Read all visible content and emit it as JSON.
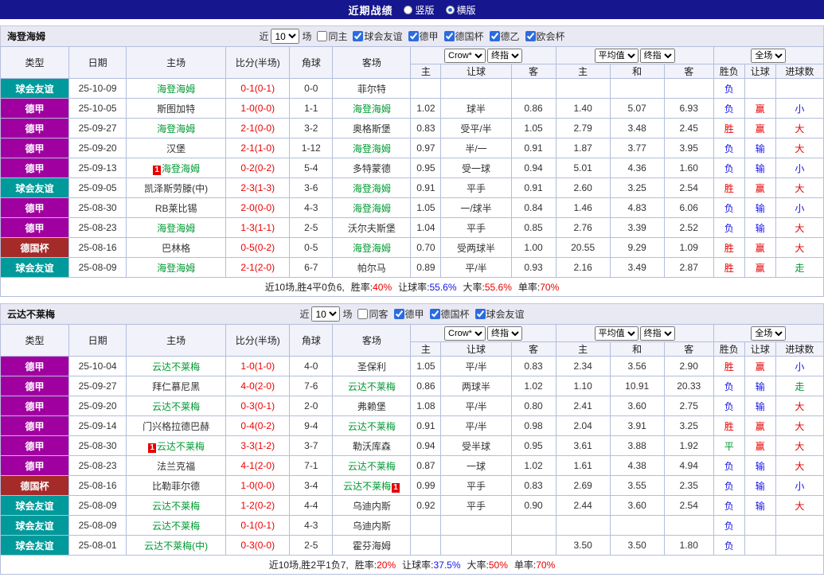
{
  "top_bar": {
    "title": "近期战绩",
    "layout_options": [
      {
        "label": "竖版",
        "selected": false
      },
      {
        "label": "横版",
        "selected": true
      }
    ]
  },
  "colors": {
    "league": {
      "球会友谊": "#009a9a",
      "德甲": "#a000a0",
      "德国杯": "#a52a2a"
    },
    "result": {
      "胜": "#e60000",
      "负": "#1414e6",
      "平": "#009933",
      "赢": "#e60000",
      "输": "#1414e6",
      "大": "#e60000",
      "小": "#1414e6",
      "走": "#009933"
    },
    "team_focus": "#009933",
    "score": "#ee0000"
  },
  "table_header": {
    "cols": [
      "类型",
      "日期",
      "主场",
      "比分(半场)",
      "角球",
      "客场"
    ],
    "odds_group1": {
      "select1": "Crow*",
      "select2": "终指",
      "sub": [
        "主",
        "让球",
        "客"
      ]
    },
    "odds_group2": {
      "select1": "平均值",
      "select2": "终指",
      "sub": [
        "主",
        "和",
        "客"
      ]
    },
    "result_group": {
      "select1": "全场",
      "sub": [
        "胜负",
        "让球",
        "进球数"
      ]
    }
  },
  "sections": [
    {
      "team": "海登海姆",
      "filter": {
        "near_label": "近",
        "count": "10",
        "games_label": "场",
        "same_label": "同主",
        "same_checked": false,
        "leagues": [
          {
            "label": "球会友谊",
            "checked": true
          },
          {
            "label": "德甲",
            "checked": true
          },
          {
            "label": "德国杯",
            "checked": true
          },
          {
            "label": "德乙",
            "checked": true
          },
          {
            "label": "欧会杯",
            "checked": true
          }
        ]
      },
      "rows": [
        {
          "league": "球会友谊",
          "date": "25-10-09",
          "home": {
            "name": "海登海姆",
            "focus": true
          },
          "score": "0-1(0-1)",
          "corner": "0-0",
          "away": {
            "name": "菲尔特",
            "focus": false
          },
          "odds": [
            "",
            "",
            ""
          ],
          "avg": [
            "",
            "",
            ""
          ],
          "result": [
            "负",
            "",
            ""
          ]
        },
        {
          "league": "德甲",
          "date": "25-10-05",
          "home": {
            "name": "斯图加特",
            "focus": false
          },
          "score": "1-0(0-0)",
          "corner": "1-1",
          "away": {
            "name": "海登海姆",
            "focus": true
          },
          "odds": [
            "1.02",
            "球半",
            "0.86"
          ],
          "avg": [
            "1.40",
            "5.07",
            "6.93"
          ],
          "result": [
            "负",
            "赢",
            "小"
          ]
        },
        {
          "league": "德甲",
          "date": "25-09-27",
          "home": {
            "name": "海登海姆",
            "focus": true
          },
          "score": "2-1(0-0)",
          "corner": "3-2",
          "away": {
            "name": "奥格斯堡",
            "focus": false
          },
          "odds": [
            "0.83",
            "受平/半",
            "1.05"
          ],
          "avg": [
            "2.79",
            "3.48",
            "2.45"
          ],
          "result": [
            "胜",
            "赢",
            "大"
          ]
        },
        {
          "league": "德甲",
          "date": "25-09-20",
          "home": {
            "name": "汉堡",
            "focus": false
          },
          "score": "2-1(1-0)",
          "corner": "1-12",
          "away": {
            "name": "海登海姆",
            "focus": true
          },
          "odds": [
            "0.97",
            "半/一",
            "0.91"
          ],
          "avg": [
            "1.87",
            "3.77",
            "3.95"
          ],
          "result": [
            "负",
            "输",
            "大"
          ]
        },
        {
          "league": "德甲",
          "date": "25-09-13",
          "home": {
            "name": "海登海姆",
            "focus": true,
            "card": "1",
            "card_side": "left"
          },
          "score": "0-2(0-2)",
          "corner": "5-4",
          "away": {
            "name": "多特蒙德",
            "focus": false
          },
          "odds": [
            "0.95",
            "受一球",
            "0.94"
          ],
          "avg": [
            "5.01",
            "4.36",
            "1.60"
          ],
          "result": [
            "负",
            "输",
            "小"
          ]
        },
        {
          "league": "球会友谊",
          "date": "25-09-05",
          "home": {
            "name": "凯泽斯劳滕(中)",
            "focus": false
          },
          "score": "2-3(1-3)",
          "corner": "3-6",
          "away": {
            "name": "海登海姆",
            "focus": true
          },
          "odds": [
            "0.91",
            "平手",
            "0.91"
          ],
          "avg": [
            "2.60",
            "3.25",
            "2.54"
          ],
          "result": [
            "胜",
            "赢",
            "大"
          ]
        },
        {
          "league": "德甲",
          "date": "25-08-30",
          "home": {
            "name": "RB莱比锡",
            "focus": false
          },
          "score": "2-0(0-0)",
          "corner": "4-3",
          "away": {
            "name": "海登海姆",
            "focus": true
          },
          "odds": [
            "1.05",
            "一/球半",
            "0.84"
          ],
          "avg": [
            "1.46",
            "4.83",
            "6.06"
          ],
          "result": [
            "负",
            "输",
            "小"
          ]
        },
        {
          "league": "德甲",
          "date": "25-08-23",
          "home": {
            "name": "海登海姆",
            "focus": true
          },
          "score": "1-3(1-1)",
          "corner": "2-5",
          "away": {
            "name": "沃尔夫斯堡",
            "focus": false
          },
          "odds": [
            "1.04",
            "平手",
            "0.85"
          ],
          "avg": [
            "2.76",
            "3.39",
            "2.52"
          ],
          "result": [
            "负",
            "输",
            "大"
          ]
        },
        {
          "league": "德国杯",
          "date": "25-08-16",
          "home": {
            "name": "巴林格",
            "focus": false
          },
          "score": "0-5(0-2)",
          "corner": "0-5",
          "away": {
            "name": "海登海姆",
            "focus": true
          },
          "odds": [
            "0.70",
            "受两球半",
            "1.00"
          ],
          "avg": [
            "20.55",
            "9.29",
            "1.09"
          ],
          "result": [
            "胜",
            "赢",
            "大"
          ]
        },
        {
          "league": "球会友谊",
          "date": "25-08-09",
          "home": {
            "name": "海登海姆",
            "focus": true
          },
          "score": "2-1(2-0)",
          "corner": "6-7",
          "away": {
            "name": "帕尔马",
            "focus": false
          },
          "odds": [
            "0.89",
            "平/半",
            "0.93"
          ],
          "avg": [
            "2.16",
            "3.49",
            "2.87"
          ],
          "result": [
            "胜",
            "赢",
            "走"
          ]
        }
      ],
      "summary": {
        "prefix": "近10场,胜4平0负6,",
        "stats": [
          {
            "label": "胜率:",
            "value": "40%",
            "color": "#e60000"
          },
          {
            "label": "让球率:",
            "value": "55.6%",
            "color": "#1414e6"
          },
          {
            "label": "大率:",
            "value": "55.6%",
            "color": "#e60000"
          },
          {
            "label": "单率:",
            "value": "70%",
            "color": "#e60000"
          }
        ]
      }
    },
    {
      "team": "云达不莱梅",
      "filter": {
        "near_label": "近",
        "count": "10",
        "games_label": "场",
        "same_label": "同客",
        "same_checked": false,
        "leagues": [
          {
            "label": "德甲",
            "checked": true
          },
          {
            "label": "德国杯",
            "checked": true
          },
          {
            "label": "球会友谊",
            "checked": true
          }
        ]
      },
      "rows": [
        {
          "league": "德甲",
          "date": "25-10-04",
          "home": {
            "name": "云达不莱梅",
            "focus": true
          },
          "score": "1-0(1-0)",
          "corner": "4-0",
          "away": {
            "name": "圣保利",
            "focus": false
          },
          "odds": [
            "1.05",
            "平/半",
            "0.83"
          ],
          "avg": [
            "2.34",
            "3.56",
            "2.90"
          ],
          "result": [
            "胜",
            "赢",
            "小"
          ]
        },
        {
          "league": "德甲",
          "date": "25-09-27",
          "home": {
            "name": "拜仁慕尼黑",
            "focus": false
          },
          "score": "4-0(2-0)",
          "corner": "7-6",
          "away": {
            "name": "云达不莱梅",
            "focus": true
          },
          "odds": [
            "0.86",
            "两球半",
            "1.02"
          ],
          "avg": [
            "1.10",
            "10.91",
            "20.33"
          ],
          "result": [
            "负",
            "输",
            "走"
          ]
        },
        {
          "league": "德甲",
          "date": "25-09-20",
          "home": {
            "name": "云达不莱梅",
            "focus": true
          },
          "score": "0-3(0-1)",
          "corner": "2-0",
          "away": {
            "name": "弗赖堡",
            "focus": false
          },
          "odds": [
            "1.08",
            "平/半",
            "0.80"
          ],
          "avg": [
            "2.41",
            "3.60",
            "2.75"
          ],
          "result": [
            "负",
            "输",
            "大"
          ]
        },
        {
          "league": "德甲",
          "date": "25-09-14",
          "home": {
            "name": "门兴格拉德巴赫",
            "focus": false
          },
          "score": "0-4(0-2)",
          "corner": "9-4",
          "away": {
            "name": "云达不莱梅",
            "focus": true
          },
          "odds": [
            "0.91",
            "平/半",
            "0.98"
          ],
          "avg": [
            "2.04",
            "3.91",
            "3.25"
          ],
          "result": [
            "胜",
            "赢",
            "大"
          ]
        },
        {
          "league": "德甲",
          "date": "25-08-30",
          "home": {
            "name": "云达不莱梅",
            "focus": true,
            "card": "1",
            "card_side": "left"
          },
          "score": "3-3(1-2)",
          "corner": "3-7",
          "away": {
            "name": "勒沃库森",
            "focus": false
          },
          "odds": [
            "0.94",
            "受半球",
            "0.95"
          ],
          "avg": [
            "3.61",
            "3.88",
            "1.92"
          ],
          "result": [
            "平",
            "赢",
            "大"
          ]
        },
        {
          "league": "德甲",
          "date": "25-08-23",
          "home": {
            "name": "法兰克福",
            "focus": false
          },
          "score": "4-1(2-0)",
          "corner": "7-1",
          "away": {
            "name": "云达不莱梅",
            "focus": true
          },
          "odds": [
            "0.87",
            "一球",
            "1.02"
          ],
          "avg": [
            "1.61",
            "4.38",
            "4.94"
          ],
          "result": [
            "负",
            "输",
            "大"
          ]
        },
        {
          "league": "德国杯",
          "date": "25-08-16",
          "home": {
            "name": "比勒菲尔德",
            "focus": false
          },
          "score": "1-0(0-0)",
          "corner": "3-4",
          "away": {
            "name": "云达不莱梅",
            "focus": true,
            "card": "1",
            "card_side": "right"
          },
          "odds": [
            "0.99",
            "平手",
            "0.83"
          ],
          "avg": [
            "2.69",
            "3.55",
            "2.35"
          ],
          "result": [
            "负",
            "输",
            "小"
          ]
        },
        {
          "league": "球会友谊",
          "date": "25-08-09",
          "home": {
            "name": "云达不莱梅",
            "focus": true
          },
          "score": "1-2(0-2)",
          "corner": "4-4",
          "away": {
            "name": "乌迪内斯",
            "focus": false
          },
          "odds": [
            "0.92",
            "平手",
            "0.90"
          ],
          "avg": [
            "2.44",
            "3.60",
            "2.54"
          ],
          "result": [
            "负",
            "输",
            "大"
          ]
        },
        {
          "league": "球会友谊",
          "date": "25-08-09",
          "home": {
            "name": "云达不莱梅",
            "focus": true
          },
          "score": "0-1(0-1)",
          "corner": "4-3",
          "away": {
            "name": "乌迪内斯",
            "focus": false
          },
          "odds": [
            "",
            "",
            ""
          ],
          "avg": [
            "",
            "",
            ""
          ],
          "result": [
            "负",
            "",
            ""
          ]
        },
        {
          "league": "球会友谊",
          "date": "25-08-01",
          "home": {
            "name": "云达不莱梅(中)",
            "focus": true
          },
          "score": "0-3(0-0)",
          "corner": "2-5",
          "away": {
            "name": "霍芬海姆",
            "focus": false
          },
          "odds": [
            "",
            "",
            ""
          ],
          "avg": [
            "3.50",
            "3.50",
            "1.80"
          ],
          "result": [
            "负",
            "",
            ""
          ]
        }
      ],
      "summary": {
        "prefix": "近10场,胜2平1负7,",
        "stats": [
          {
            "label": "胜率:",
            "value": "20%",
            "color": "#e60000"
          },
          {
            "label": "让球率:",
            "value": "37.5%",
            "color": "#1414e6"
          },
          {
            "label": "大率:",
            "value": "50%",
            "color": "#e60000"
          },
          {
            "label": "单率:",
            "value": "70%",
            "color": "#e60000"
          }
        ]
      }
    }
  ]
}
